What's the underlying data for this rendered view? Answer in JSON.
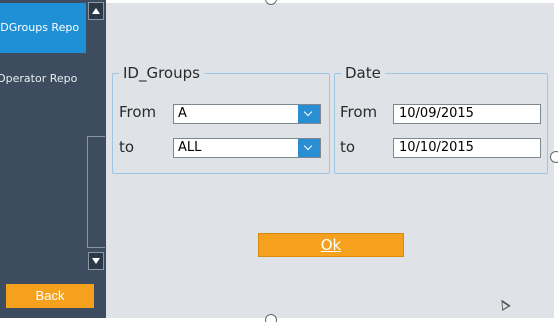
{
  "sidebar": {
    "items": [
      {
        "label": "IDGroups Repo"
      },
      {
        "label": "Operator Repo"
      }
    ],
    "back_label": "Back"
  },
  "id_groups": {
    "legend": "ID_Groups",
    "from_label": "From",
    "from_value": "A",
    "to_label": "to",
    "to_value": "ALL"
  },
  "date": {
    "legend": "Date",
    "from_label": "From",
    "from_value": "10/09/2015",
    "to_label": "to",
    "to_value": "10/10/2015"
  },
  "ok_label": "Ok",
  "colors": {
    "accent_orange": "#f5a11e",
    "selected_blue": "#1f8fd6",
    "sidebar_bg": "#3d4d5f",
    "panel_bg": "#dfe3e7"
  },
  "icons": [
    "scroll-up-icon",
    "scroll-down-icon",
    "chevron-down-icon",
    "mouse-cursor-icon"
  ]
}
